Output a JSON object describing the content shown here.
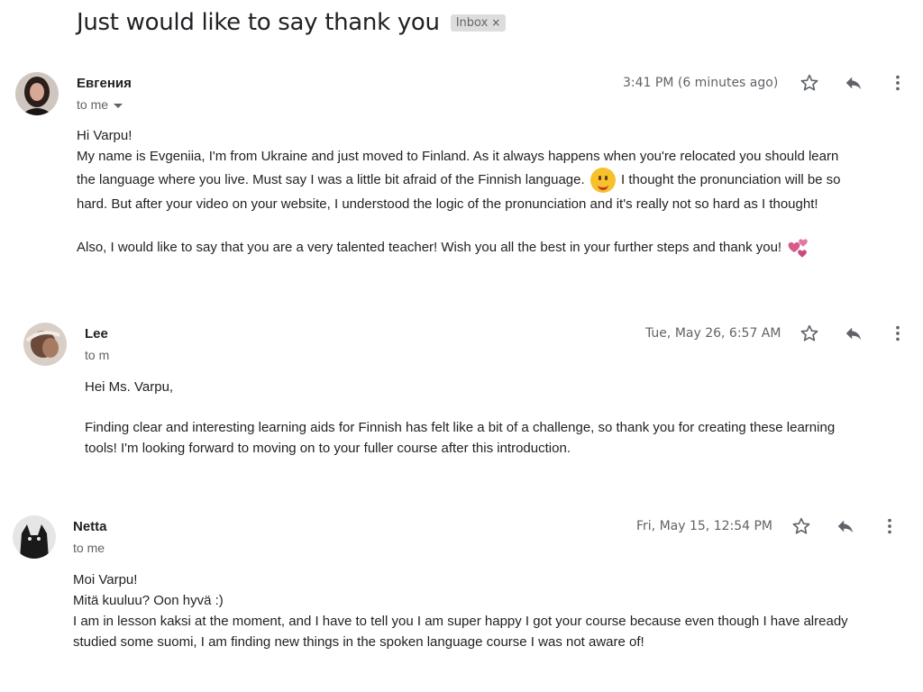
{
  "thread": {
    "subject": "Just would like to say thank you",
    "label": "Inbox",
    "label_remove": "×"
  },
  "messages": [
    {
      "sender": "Евгения",
      "recipient": "to me",
      "date": "3:41 PM (6 minutes ago)",
      "lines": [
        "Hi Varpu!",
        "My name is Evgeniia, I'm from Ukraine and just moved to Finland. As it always happens when you're relocated you should learn",
        "the language where you live. Must say I was a little bit afraid of the Finnish language.",
        "I thought the pronunciation will be so",
        "hard. But after your video on your website, I understood the logic of the pronunciation and it's really not so hard as I thought!",
        "Also, I would like to say that you are a very talented teacher!  Wish you all the best in your further steps and thank you!"
      ]
    },
    {
      "sender": "Lee",
      "recipient": "to m",
      "date": "Tue, May 26, 6:57 AM",
      "lines": [
        "Hei Ms. Varpu,",
        "Finding clear and interesting learning aids for Finnish has felt like a bit of a challenge, so thank you for creating these learning",
        "tools! I'm looking forward to moving on to your fuller course after this introduction."
      ]
    },
    {
      "sender": "Netta",
      "recipient": "to me",
      "date": "Fri, May 15, 12:54 PM",
      "lines": [
        "Moi Varpu!",
        "Mitä kuuluu? Oon hyvä :)",
        "I am in lesson kaksi at the moment, and I have to tell you I am super happy I got your course because even though I have already",
        "studied some suomi, I am finding new things in the spoken language course I was not aware of!"
      ]
    }
  ],
  "icons": {
    "star": "star-icon",
    "reply": "reply-icon",
    "more": "more-vertical-icon",
    "caret": "caret-down-icon"
  },
  "colors": {
    "label_bg": "#dddddd",
    "meta_text": "#5f6368",
    "smile_emoji": "#f6c12a",
    "heart_emoji": "#d85a8a"
  }
}
